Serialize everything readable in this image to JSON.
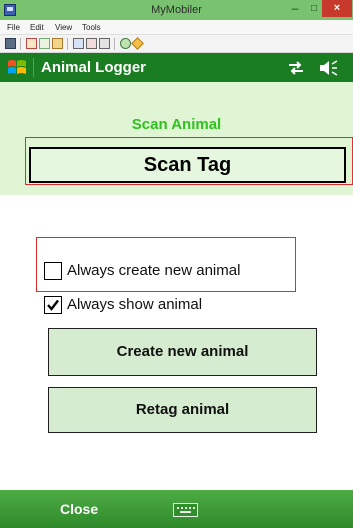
{
  "window": {
    "title": "MyMobiler",
    "minimize": "–",
    "maximize": "□",
    "close": "×",
    "menus": [
      "File",
      "Edit",
      "View",
      "Tools"
    ]
  },
  "device": {
    "app_title": "Animal Logger"
  },
  "screen": {
    "section_title": "Scan Animal",
    "scan_button": "Scan Tag",
    "options": [
      {
        "label": "Always create new animal",
        "checked": false
      },
      {
        "label": "Always show animal",
        "checked": true
      }
    ],
    "create_button": "Create new animal",
    "retag_button": "Retag animal"
  },
  "softkeys": {
    "left": "Close"
  },
  "colors": {
    "wm_titlebar": "#1a7d22",
    "panel_bg": "#dff5d3",
    "section_title": "#2ec21e",
    "highlight_border": "#e02c2c",
    "softkey_bar": "#3f9f3a"
  }
}
